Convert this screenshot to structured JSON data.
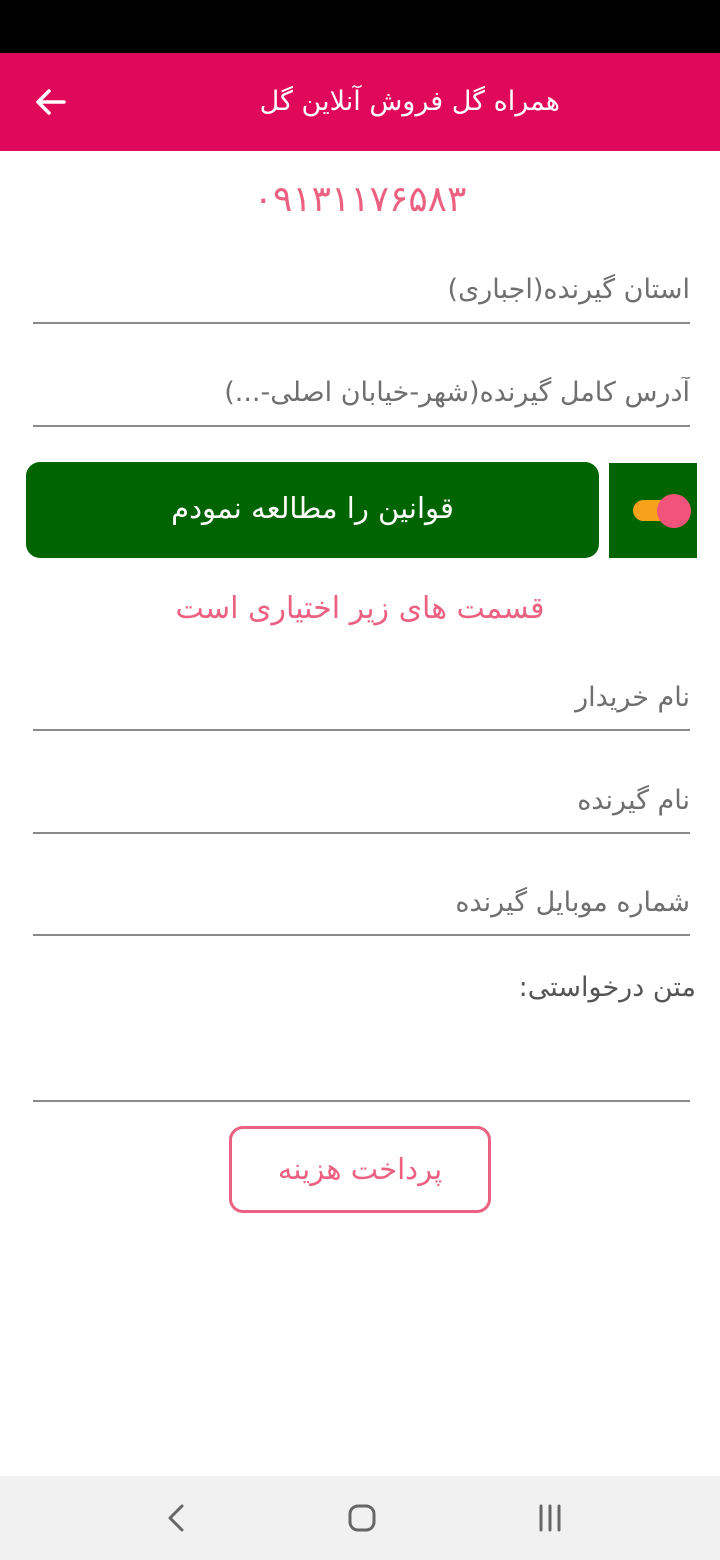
{
  "app_bar": {
    "title": "همراه گل فروش آنلاین گل",
    "back_icon": "arrow-left-icon",
    "background": "#e0085a"
  },
  "phone_number": "۰۹۱۳۱۱۷۶۵۸۳",
  "form": {
    "province_placeholder": "استان گیرنده(اجباری)",
    "address_placeholder": "آدرس کامل گیرنده(شهر-خیابان اصلی-...)",
    "rules_button_label": "قوانین را مطالعه نمودم",
    "rules_toggle_on": true,
    "optional_note": "قسمت های زیر اختیاری است",
    "buyer_name_placeholder": "نام خریدار",
    "receiver_name_placeholder": "نام گیرنده",
    "receiver_mobile_placeholder": "شماره موبایل گیرنده",
    "request_text_label": "متن درخواستی:",
    "pay_button_label": "پرداخت هزینه"
  },
  "colors": {
    "accent": "#e0085a",
    "pink_text": "#ec6181",
    "green_button": "#006400",
    "toggle_track": "#f6a21a",
    "toggle_thumb": "#f2537a"
  },
  "nav_bar": {
    "back_icon": "chevron-left-icon",
    "home_icon": "home-square-icon",
    "recents_icon": "recents-lines-icon"
  }
}
